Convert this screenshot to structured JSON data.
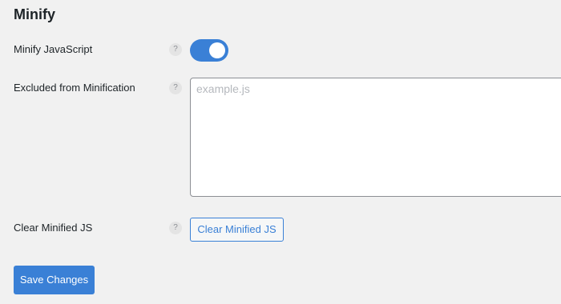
{
  "section": {
    "title": "Minify"
  },
  "rows": {
    "minify_js": {
      "label": "Minify JavaScript",
      "help": "?",
      "toggle_enabled": true
    },
    "excluded": {
      "label": "Excluded from Minification",
      "help": "?",
      "value": "",
      "placeholder": "example.js"
    },
    "clear": {
      "label": "Clear Minified JS",
      "help": "?",
      "button_label": "Clear Minified JS"
    }
  },
  "actions": {
    "save_label": "Save Changes"
  },
  "colors": {
    "accent": "#3a80d6",
    "background": "#f1f1f1",
    "text": "#1d2327"
  },
  "icons": {
    "help": "help-question-icon"
  }
}
